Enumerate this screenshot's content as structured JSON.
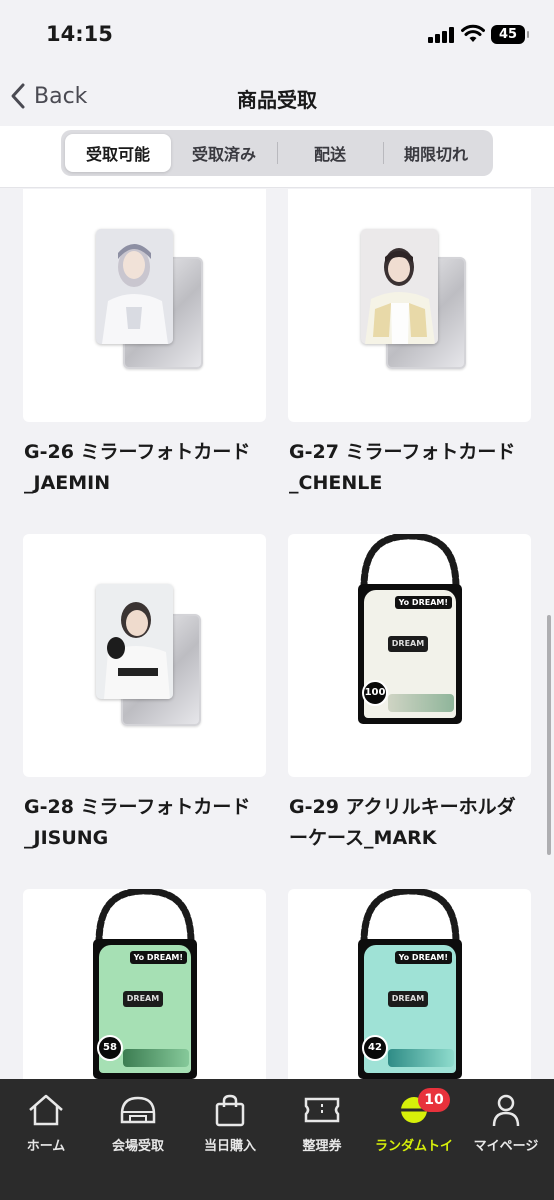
{
  "status_bar": {
    "time": "14:15",
    "battery": "45"
  },
  "nav": {
    "back_label": "Back",
    "title": "商品受取"
  },
  "segments": [
    {
      "label": "受取可能",
      "active": true
    },
    {
      "label": "受取済み",
      "active": false
    },
    {
      "label": "配送",
      "active": false
    },
    {
      "label": "期限切れ",
      "active": false
    }
  ],
  "items": [
    {
      "name": "G-26 ミラーフォトカード_JAEMIN",
      "kind": "photocard"
    },
    {
      "name": "G-27 ミラーフォトカード_CHENLE",
      "kind": "photocard"
    },
    {
      "name": "G-28 ミラーフォトカード_JISUNG",
      "kind": "photocard"
    },
    {
      "name": "G-29 アクリルキーホルダーケース_MARK",
      "kind": "keyholder",
      "number": "100",
      "tag": "Yo DREAM!",
      "accent": "#f2f2ea"
    },
    {
      "name": "",
      "kind": "keyholder",
      "number": "58",
      "tag": "Yo DREAM!",
      "accent": "#a6e0b4"
    },
    {
      "name": "",
      "kind": "keyholder",
      "number": "42",
      "tag": "Yo DREAM!",
      "accent": "#9fe2d6"
    }
  ],
  "tabbar": {
    "items": [
      {
        "label": "ホーム",
        "icon": "home-icon"
      },
      {
        "label": "会場受取",
        "icon": "venue-icon"
      },
      {
        "label": "当日購入",
        "icon": "shopping-bag-icon"
      },
      {
        "label": "整理券",
        "icon": "ticket-icon"
      },
      {
        "label": "ランダムトイ",
        "icon": "random-toy-icon",
        "active": true,
        "badge": "10"
      },
      {
        "label": "マイページ",
        "icon": "person-icon"
      }
    ],
    "active_color": "#d7f00a",
    "badge_color": "#e8323c"
  }
}
